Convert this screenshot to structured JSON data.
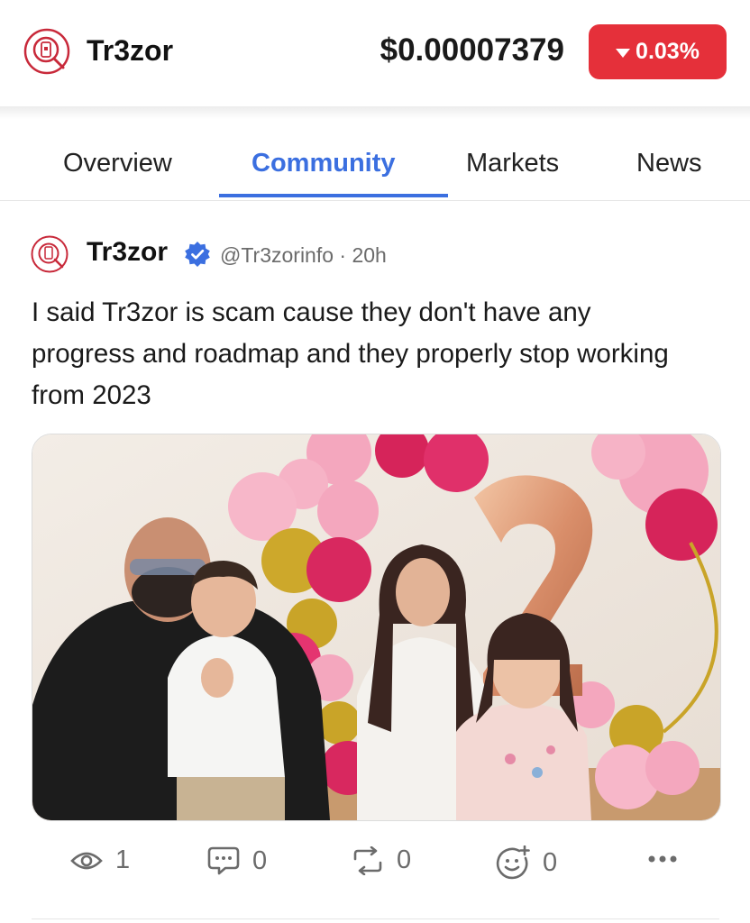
{
  "header": {
    "app_name": "Tr3zor",
    "price": "$0.00007379",
    "change": "0.03%",
    "change_color": "#e5303a"
  },
  "tabs": [
    {
      "label": "Overview",
      "active": false
    },
    {
      "label": "Community",
      "active": true
    },
    {
      "label": "Markets",
      "active": false
    },
    {
      "label": "News",
      "active": false
    }
  ],
  "post": {
    "author": "Tr3zor",
    "meta": "@Tr3zorinfo · 20h",
    "text": "I said Tr3zor is scam cause they don't have any progress and roadmap and they properly stop working from 2023",
    "views": "1",
    "comments": "0",
    "reposts": "0",
    "reactions": "0"
  },
  "colors": {
    "accent": "#3b6fe0",
    "brand": "#c8293a",
    "muted": "#6b6b6b"
  },
  "icons": [
    "logo-icon",
    "verified-badge-icon",
    "eye-icon",
    "comment-icon",
    "repost-icon",
    "add-reaction-icon",
    "more-icon"
  ]
}
